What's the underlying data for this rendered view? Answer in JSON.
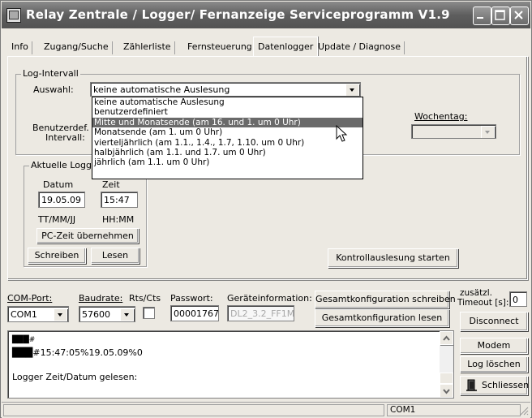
{
  "window": {
    "title": "Relay Zentrale / Logger/ Fernanzeige Serviceprogramm  V1.9"
  },
  "tabs": [
    {
      "label": "Info"
    },
    {
      "label": "Zugang/Suche"
    },
    {
      "label": "Zählerliste"
    },
    {
      "label": "Fernsteuerung"
    },
    {
      "label": "Datenlogger"
    },
    {
      "label": "Update / Diagnose"
    }
  ],
  "active_tab": "Datenlogger",
  "log_interval": {
    "legend": "Log-Intervall",
    "auswahl_label": "Auswahl:",
    "auswahl_value": "keine automatische Auslesung",
    "options": [
      "keine automatische Auslesung",
      "benutzerdefiniert",
      "Mitte und Monatsende (am 16. und 1. um 0 Uhr)",
      "Monatsende (am 1. um 0 Uhr)",
      "vierteljährlich (am 1.1., 1.4., 1.7, 1.10. um 0 Uhr)",
      "halbjährlich (am 1.1. und 1.7. um 0 Uhr)",
      "jährlich (am 1.1. um 0 Uhr)"
    ],
    "highlighted_option": "Mitte und Monatsende (am 16. und 1. um 0 Uhr)",
    "benutzerdef_label1": "Benutzerdef.",
    "benutzerdef_label2": "Intervall:",
    "wochentag_label": "Wochentag:",
    "wochentag_value": ""
  },
  "logger_time": {
    "legend": "Aktuelle Logg",
    "datum_label": "Datum",
    "zeit_label": "Zeit",
    "datum_value": "19.05.09",
    "zeit_value": "15:47",
    "datum_format": "TT/MM/JJ",
    "zeit_format": "HH:MM",
    "pc_time_button": "PC-Zeit übernehmen",
    "write_button": "Schreiben",
    "read_button": "Lesen"
  },
  "control_button": "Kontrollauslesung starten",
  "connection": {
    "com_port_label": "COM-Port:",
    "com_port_value": "COM1",
    "baud_label": "Baudrate:",
    "baud_value": "57600",
    "rtscts_label": "Rts/Cts",
    "rtscts_checked": false,
    "password_label": "Passwort:",
    "password_value": "00001767",
    "device_info_label": "Geräteinformation:",
    "device_info_value": "DL2_3.2_FF1M",
    "write_config_button": "Gesamtkonfiguration schreiben",
    "read_config_button": "Gesamtkonfiguration lesen",
    "timeout_label1": "zusätzl.",
    "timeout_label2": "Timeout [s]:",
    "timeout_value": "0",
    "disconnect_button": "Disconnect"
  },
  "log_output": {
    "lines": [
      "███#",
      "███#15:47:05%19.05.09%0",
      "Logger Zeit/Datum gelesen:"
    ]
  },
  "side_buttons": {
    "modem": "Modem",
    "clear_log": "Log löschen",
    "close": "Schliessen"
  },
  "statusbar": {
    "port": "COM1"
  }
}
